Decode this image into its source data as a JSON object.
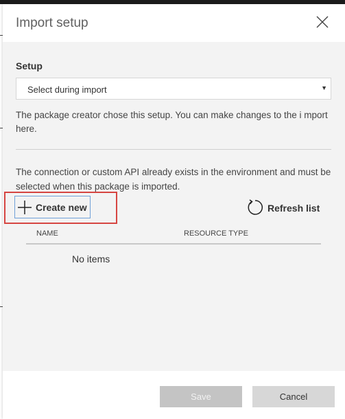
{
  "dialog": {
    "title": "Import setup",
    "close_icon": "close-icon"
  },
  "setup": {
    "label": "Setup",
    "selected": "Select during import",
    "caret_icon": "caret-down-icon",
    "note": "The package creator chose this setup. You can make changes to the i mport here."
  },
  "connection": {
    "note": "The connection or custom API already exists in the environment and must be selected when this package is imported.",
    "create_new_label": "Create new",
    "create_new_icon": "plus-icon",
    "refresh_label": "Refresh list",
    "refresh_icon": "refresh-icon"
  },
  "table": {
    "columns": [
      "NAME",
      "RESOURCE TYPE"
    ],
    "empty_text": "No items"
  },
  "footer": {
    "save_label": "Save",
    "cancel_label": "Cancel"
  },
  "colors": {
    "highlight": "#d64541",
    "focus_border": "#6fa0d8"
  }
}
